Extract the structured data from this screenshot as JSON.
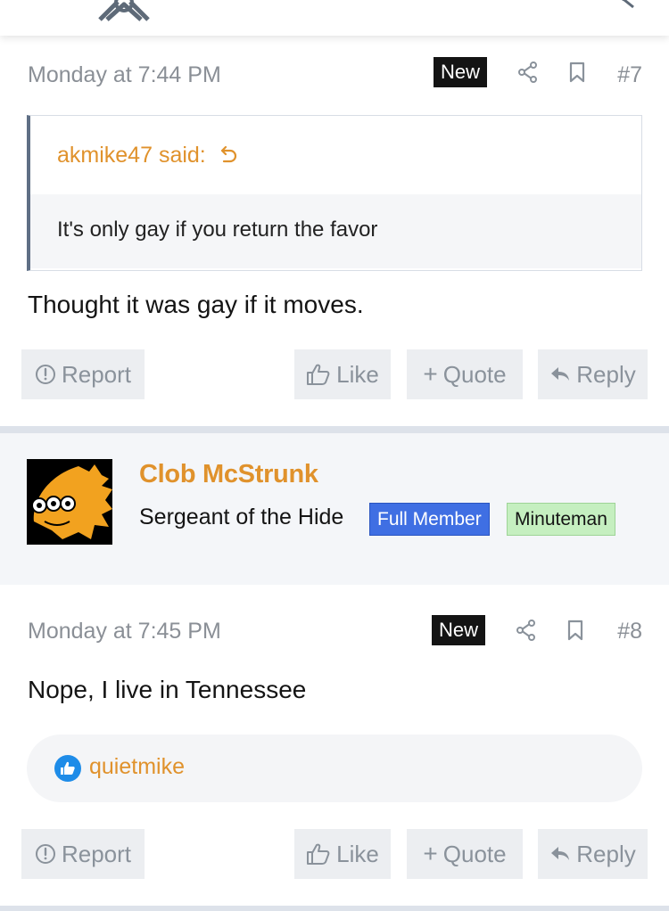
{
  "post7": {
    "date": "Monday at 7:44 PM",
    "new_badge": "New",
    "number": "#7",
    "quote_author": "akmike47 said:",
    "quote_text": "It's only gay if you return the favor",
    "text": "Thought it was gay if it moves."
  },
  "user": {
    "name": "Clob McStrunk",
    "title": "Sergeant of the Hide",
    "badge_primary": "Full Member",
    "badge_secondary": "Minuteman"
  },
  "post8": {
    "date": "Monday at 7:45 PM",
    "new_badge": "New",
    "number": "#8",
    "text": "Nope, I live in Tennessee",
    "reaction_user": "quietmike"
  },
  "actions": {
    "report": "Report",
    "like": "Like",
    "quote": "Quote",
    "reply": "Reply"
  },
  "colors": {
    "accent_orange": "#e0922c",
    "badge_full_member": "#3f6fe3",
    "badge_minuteman": "#c5efc0"
  }
}
